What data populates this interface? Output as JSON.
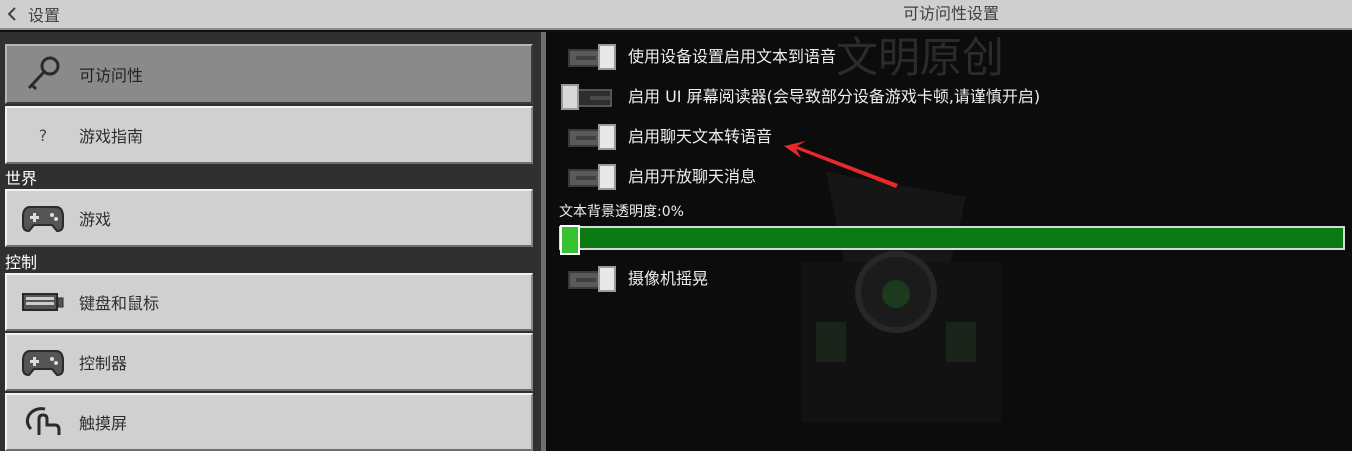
{
  "header": {
    "back_label": "设置",
    "title": "可访问性设置"
  },
  "sidebar": {
    "items": [
      {
        "label": "可访问性",
        "icon": "key-icon",
        "selected": true
      },
      {
        "label": "游戏指南",
        "icon": "question-icon",
        "selected": false
      }
    ],
    "sections": [
      {
        "title": "世界",
        "items": [
          {
            "label": "游戏",
            "icon": "gamepad-icon"
          }
        ]
      },
      {
        "title": "控制",
        "items": [
          {
            "label": "键盘和鼠标",
            "icon": "keyboard-icon"
          },
          {
            "label": "控制器",
            "icon": "gamepad-icon"
          },
          {
            "label": "触摸屏",
            "icon": "touch-icon"
          }
        ]
      }
    ]
  },
  "settings": {
    "options": [
      {
        "label": "使用设备设置启用文本到语音",
        "enabled": false
      },
      {
        "label": "启用 UI 屏幕阅读器(会导致部分设备游戏卡顿,请谨慎开启)",
        "enabled": false
      },
      {
        "label": "启用聊天文本转语音",
        "enabled": false
      },
      {
        "label": "启用开放聊天消息",
        "enabled": false
      }
    ],
    "slider": {
      "label": "文本背景透明度:0%",
      "value": 0
    },
    "camera_shake": {
      "label": "摄像机摇晃",
      "enabled": false
    }
  },
  "colors": {
    "slider_green": "#0c7a12",
    "annotation_arrow": "#e8292a"
  }
}
